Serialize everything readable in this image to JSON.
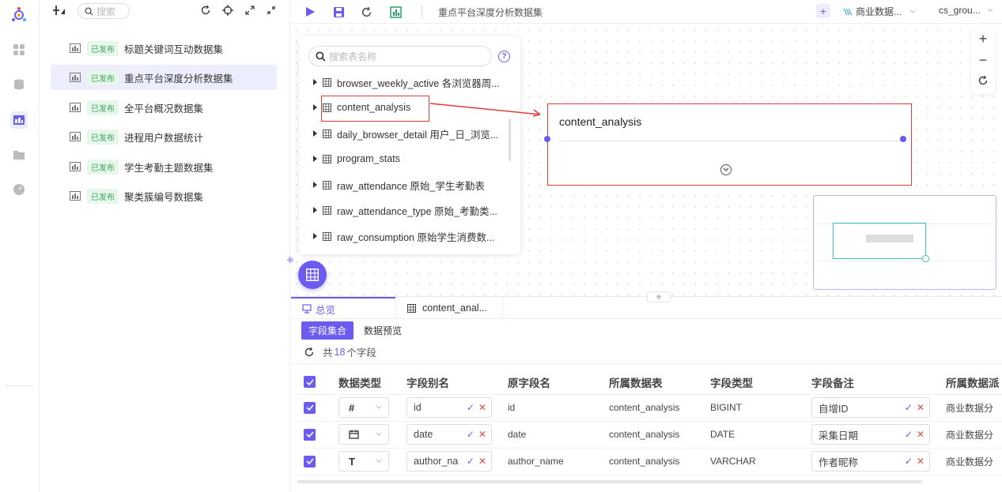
{
  "list_panel": {
    "search_placeholder": "搜索",
    "datasets": [
      {
        "status": "已发布",
        "name": "标题关键词互动数据集"
      },
      {
        "status": "已发布",
        "name": "重点平台深度分析数据集"
      },
      {
        "status": "已发布",
        "name": "全平台概况数据集"
      },
      {
        "status": "已发布",
        "name": "进程用户数据统计"
      },
      {
        "status": "已发布",
        "name": "学生考勤主题数据集"
      },
      {
        "status": "已发布",
        "name": "聚类簇编号数据集"
      }
    ],
    "selected_index": 1
  },
  "toolbar": {
    "title": "重点平台深度分析数据集",
    "datasource": "商业数据...",
    "schema": "cs_grou..."
  },
  "table_list": {
    "search_placeholder": "搜索表名称",
    "help": "?",
    "tables": [
      "browser_weekly_active 各浏览器周...",
      "content_analysis",
      "daily_browser_detail 用户_日_浏览...",
      "program_stats",
      "raw_attendance 原始_学生考勤表",
      "raw_attendance_type 原始_考勤类...",
      "raw_consumption 原始学生消费数..."
    ]
  },
  "node": {
    "title": "content_analysis"
  },
  "bottom": {
    "tabs": [
      "总览",
      "content_anal..."
    ],
    "subtabs": [
      "字段集合",
      "数据预览"
    ],
    "count_prefix": "共",
    "count": "18",
    "count_suffix": "个字段",
    "columns": [
      "数据类型",
      "字段别名",
      "原字段名",
      "所属数据表",
      "字段类型",
      "字段备注",
      "所属数据派"
    ],
    "rows": [
      {
        "type_icon": "#",
        "alias": "id",
        "original": "id",
        "table": "content_analysis",
        "field_type": "BIGINT",
        "note": "自增ID",
        "source": "商业数据分"
      },
      {
        "type_icon": "calendar",
        "alias": "date",
        "original": "date",
        "table": "content_analysis",
        "field_type": "DATE",
        "note": "采集日期",
        "source": "商业数据分"
      },
      {
        "type_icon": "T",
        "alias": "author_na",
        "original": "author_name",
        "table": "content_analysis",
        "field_type": "VARCHAR",
        "note": "作者昵称",
        "source": "商业数据分"
      }
    ]
  },
  "colors": {
    "accent": "#6b5bf0",
    "highlight_red": "#e03c3c",
    "published_green": "#3aa55a"
  }
}
